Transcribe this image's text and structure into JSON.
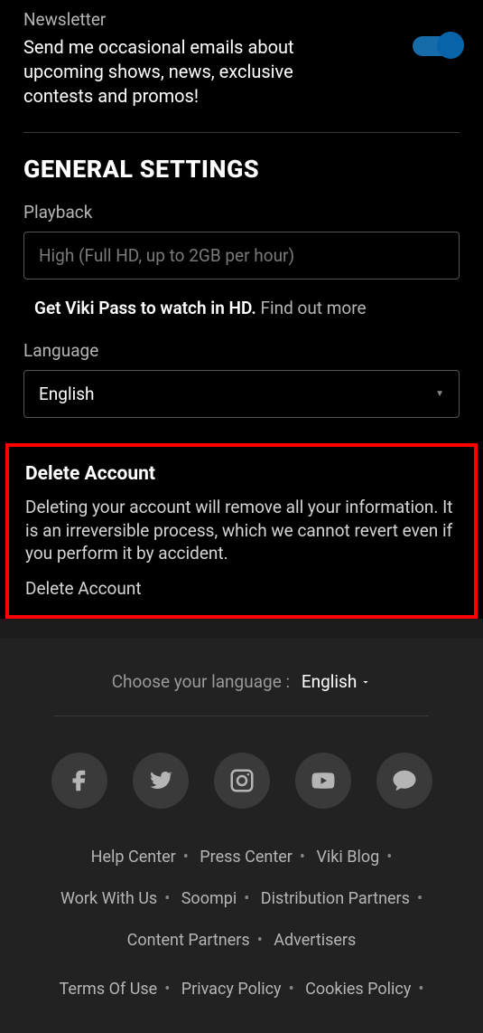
{
  "newsletter": {
    "title": "Newsletter",
    "description": "Send me occasional emails about upcoming shows, news, exclusive contests and promos!"
  },
  "general": {
    "heading": "GENERAL SETTINGS",
    "playback_label": "Playback",
    "playback_value": "High (Full HD, up to 2GB per hour)",
    "hd_hint_bold": "Get Viki Pass to watch in HD.",
    "hd_hint_link": "Find out more",
    "language_label": "Language",
    "language_value": "English"
  },
  "delete": {
    "title": "Delete Account",
    "description": "Deleting your account will remove all your information. It is an irreversible process, which we cannot revert even if you perform it by accident.",
    "link": "Delete Account"
  },
  "footer": {
    "lang_label": "Choose your language :",
    "lang_value": "English",
    "links1": [
      "Help Center",
      "Press Center",
      "Viki Blog"
    ],
    "links2": [
      "Work With Us",
      "Soompi",
      "Distribution Partners"
    ],
    "links3": [
      "Content Partners",
      "Advertisers"
    ],
    "links4": [
      "Terms Of Use",
      "Privacy Policy",
      "Cookies Policy"
    ]
  }
}
